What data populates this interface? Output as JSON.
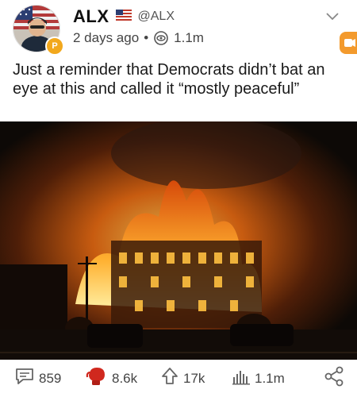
{
  "post": {
    "author_name": "ALX",
    "handle": "@ALX",
    "time_ago": "2 days ago",
    "separator": "•",
    "view_count": "1.1m",
    "text": "Just a reminder that Democrats didn’t bat an eye at this and called it “mostly peaceful”",
    "author_badge_glyph": "P",
    "icons": [
      "us-flag-icon",
      "eye-icon",
      "chevron-down-icon",
      "app-badge-icon"
    ]
  },
  "actions": {
    "comments": "859",
    "likes": "8.6k",
    "shares": "17k",
    "views": "1.1m",
    "icons": [
      "comment-icon",
      "boxing-glove-icon",
      "share-arrow-icon",
      "bar-chart-icon",
      "share-network-icon"
    ]
  },
  "colors": {
    "accent_orange": "#f39a2d",
    "like_red": "#d0281e",
    "fire_orange": "#ff8a1a",
    "sky_dark": "#0d0906"
  }
}
